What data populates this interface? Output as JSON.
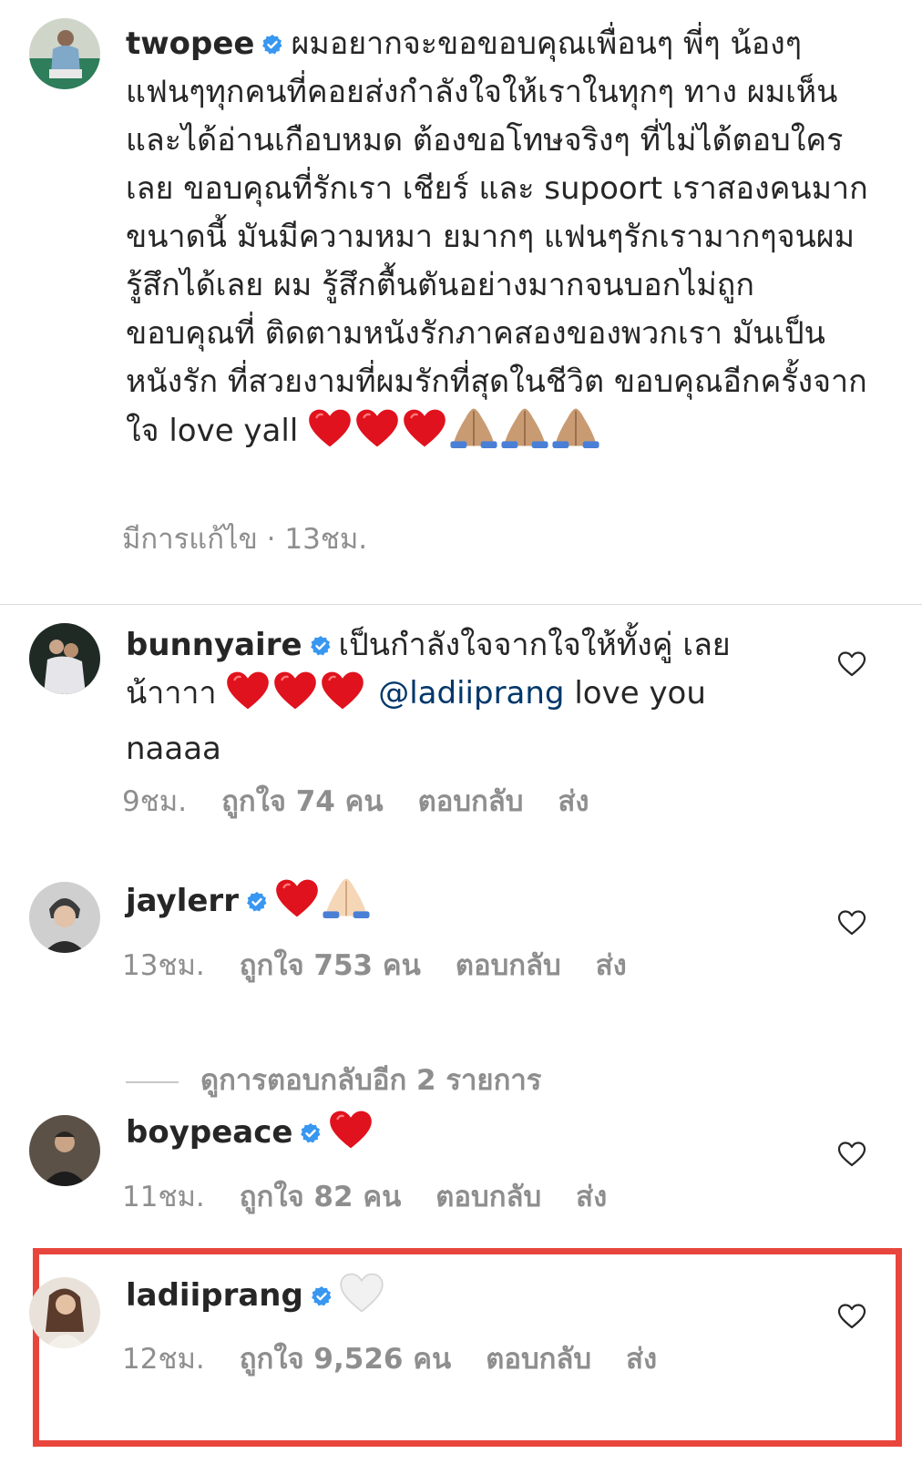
{
  "post": {
    "username": "twopee",
    "caption_text": "ผมอยากจะขอขอบคุณเพื่อนๆ พี่ๆ น้องๆ แฟนๆทุกคนที่คอยส่งกำลังใจให้เราในทุกๆ ทาง ผมเห็นและได้อ่านเกือบหมด ต้องขอโทษจริงๆ ที่ไม่ได้ตอบใครเลย ขอบคุณที่รักเรา เชียร์ และ supoort เราสองคนมากขนาดนี้ มันมีความหมา ยมากๆ แฟนๆรักเรามากๆจนผมรู้สึกได้เลย ผม รู้สึกตื้นตันอย่างมากจนบอกไม่ถูก ขอบคุณที่ ติดตามหนังรักภาคสองของพวกเรา มันเป็นหนังรัก ที่สวยงามที่ผมรักที่สุดในชีวิต ขอบคุณอีกครั้งจาก ใจ love yall",
    "edited_label": "มีการแก้ไข · 13ชม."
  },
  "comments": [
    {
      "username": "bunnyaire",
      "text_before": "เป็นกำลังใจจากใจให้ทั้งคู่ เลยน้าาาา",
      "mention": "@ladiiprang",
      "text_after": "love you naaaa",
      "time": "9ชม.",
      "likes": "ถูกใจ 74 คน",
      "reply": "ตอบกลับ",
      "send": "ส่ง"
    },
    {
      "username": "jaylerr",
      "time": "13ชม.",
      "likes": "ถูกใจ 753 คน",
      "reply": "ตอบกลับ",
      "send": "ส่ง"
    },
    {
      "username": "boypeace",
      "time": "11ชม.",
      "likes": "ถูกใจ 82 คน",
      "reply": "ตอบกลับ",
      "send": "ส่ง"
    },
    {
      "username": "ladiiprang",
      "time": "12ชม.",
      "likes": "ถูกใจ 9,526 คน",
      "reply": "ตอบกลับ",
      "send": "ส่ง"
    }
  ],
  "view_replies": "ดูการตอบกลับอีก 2 รายการ",
  "icons": {
    "verified": "verified-badge-icon",
    "like": "heart-outline-icon",
    "red_heart": "red-heart-emoji",
    "white_heart": "white-heart-emoji",
    "praying_hands": "praying-hands-emoji"
  },
  "colors": {
    "verified": "#3897f0",
    "mention": "#00376b",
    "highlight_box": "#e8463d",
    "meta_text": "#8e8e8e"
  }
}
